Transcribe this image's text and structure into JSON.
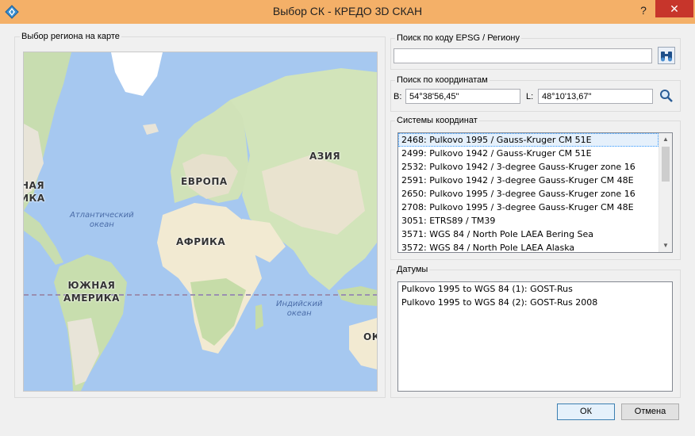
{
  "window": {
    "title": "Выбор СК - КРЕДО 3D СКАН",
    "help_label": "?",
    "close_label": "✕"
  },
  "map_group": {
    "label": "Выбор региона на карте",
    "continents": {
      "north_america": "НАЯ\nИКА",
      "europe": "ЕВРОПА",
      "asia": "АЗИЯ",
      "africa": "АФРИКА",
      "south_america": "ЮЖНАЯ\nАМЕРИКА",
      "oceania": "ОК"
    },
    "oceans": {
      "atlantic": "Атлантический\nокеан",
      "indian": "Индийский\nокеан"
    }
  },
  "epsg_search": {
    "label": "Поиск по коду EPSG / Региону",
    "value": "",
    "button_icon": "binoculars-icon"
  },
  "coord_search": {
    "label": "Поиск по координатам",
    "b_label": "B:",
    "b_value": "54°38'56,45\"",
    "l_label": "L:",
    "l_value": "48°10'13,67\"",
    "button_icon": "search-icon"
  },
  "coord_systems": {
    "label": "Системы координат",
    "items": [
      "2468: Pulkovo 1995 / Gauss-Kruger CM 51E",
      "2499: Pulkovo 1942 / Gauss-Kruger CM 51E",
      "2532: Pulkovo 1942 / 3-degree Gauss-Kruger zone 16",
      "2591: Pulkovo 1942 / 3-degree Gauss-Kruger CM 48E",
      "2650: Pulkovo 1995 / 3-degree Gauss-Kruger zone 16",
      "2708: Pulkovo 1995 / 3-degree Gauss-Kruger CM 48E",
      "3051: ETRS89 / TM39",
      "3571: WGS 84 / North Pole LAEA Bering Sea",
      "3572: WGS 84 / North Pole LAEA Alaska"
    ],
    "selected_index": 0
  },
  "datums": {
    "label": "Датумы",
    "items": [
      "Pulkovo 1995 to WGS 84 (1): GOST-Rus",
      "Pulkovo 1995 to WGS 84 (2): GOST-Rus 2008"
    ]
  },
  "buttons": {
    "ok": "ОК",
    "cancel": "Отмена"
  },
  "colors": {
    "titlebar": "#f4b068",
    "close": "#c7352b",
    "ocean": "#a6c8f0",
    "land": "#e8e4d8",
    "forest": "#bcd8a8",
    "desert": "#f2ead2"
  }
}
